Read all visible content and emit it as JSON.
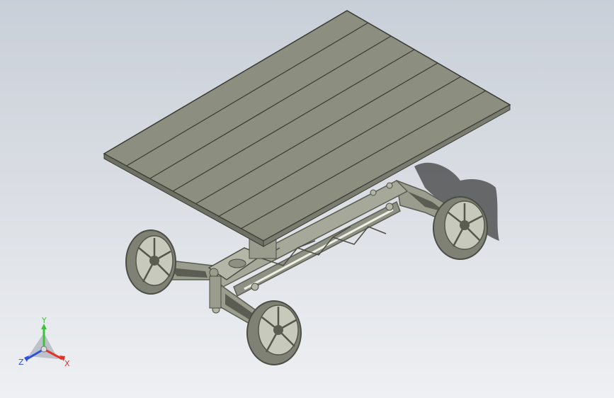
{
  "colors": {
    "background_top": "#c9cfd8",
    "background_bottom": "#eef0f3",
    "deck": "#8c8e7f",
    "deck_edge": "#6e7063",
    "plank_line": "#3a3b34",
    "frame": "#9a9c8e",
    "frame_dark": "#5b5d52",
    "shadow": "#3f3f3f",
    "axis_x": "#e0342b",
    "axis_y": "#3fc23a",
    "axis_z": "#2f4fe0"
  },
  "triad": {
    "x_label": "X",
    "y_label": "Y",
    "z_label": "Z"
  }
}
